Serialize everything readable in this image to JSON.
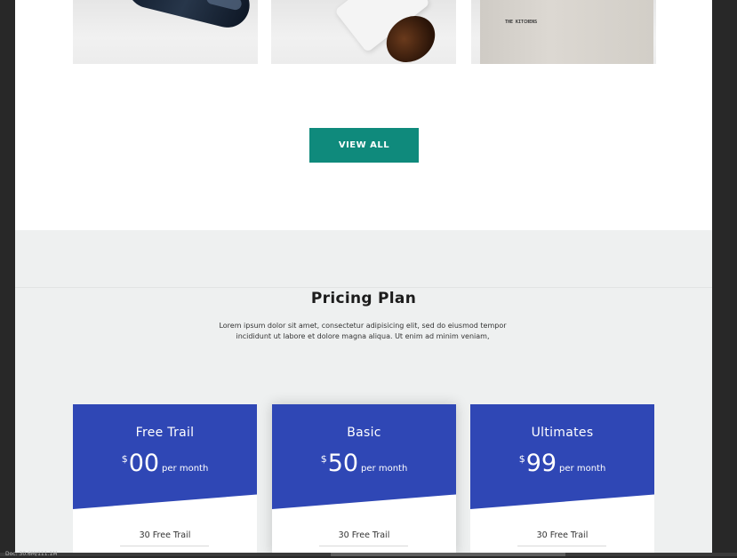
{
  "products": [
    {
      "label": "dark-bottle-product-image"
    },
    {
      "label": "amber-jar-product-image"
    },
    {
      "label": "kraft-bag-product-image",
      "bag_text": "THE KITCHENS"
    }
  ],
  "view_all_label": "VIEW ALL",
  "colors": {
    "accent_teal": "#0f8a7c",
    "plan_blue": "#2f47b5",
    "section_bg": "#eef0f0",
    "outer_bg": "#282828"
  },
  "pricing": {
    "title": "Pricing Plan",
    "description_line1": "Lorem ipsum dolor sit amet, consectetur adipisicing elit, sed do eiusmod tempor",
    "description_line2": "incididunt ut labore et dolore magna aliqua. Ut enim ad minim veniam,",
    "plans": [
      {
        "name": "Free Trail",
        "currency": "$",
        "amount": "00",
        "period": "per month",
        "feature": "30 Free Trail"
      },
      {
        "name": "Basic",
        "currency": "$",
        "amount": "50",
        "period": "per month",
        "feature": "30 Free Trail"
      },
      {
        "name": "Ultimates",
        "currency": "$",
        "amount": "99",
        "period": "per month",
        "feature": "30 Free Trail"
      }
    ]
  },
  "status": {
    "text": "Doc: 30.6M/111.1M"
  }
}
